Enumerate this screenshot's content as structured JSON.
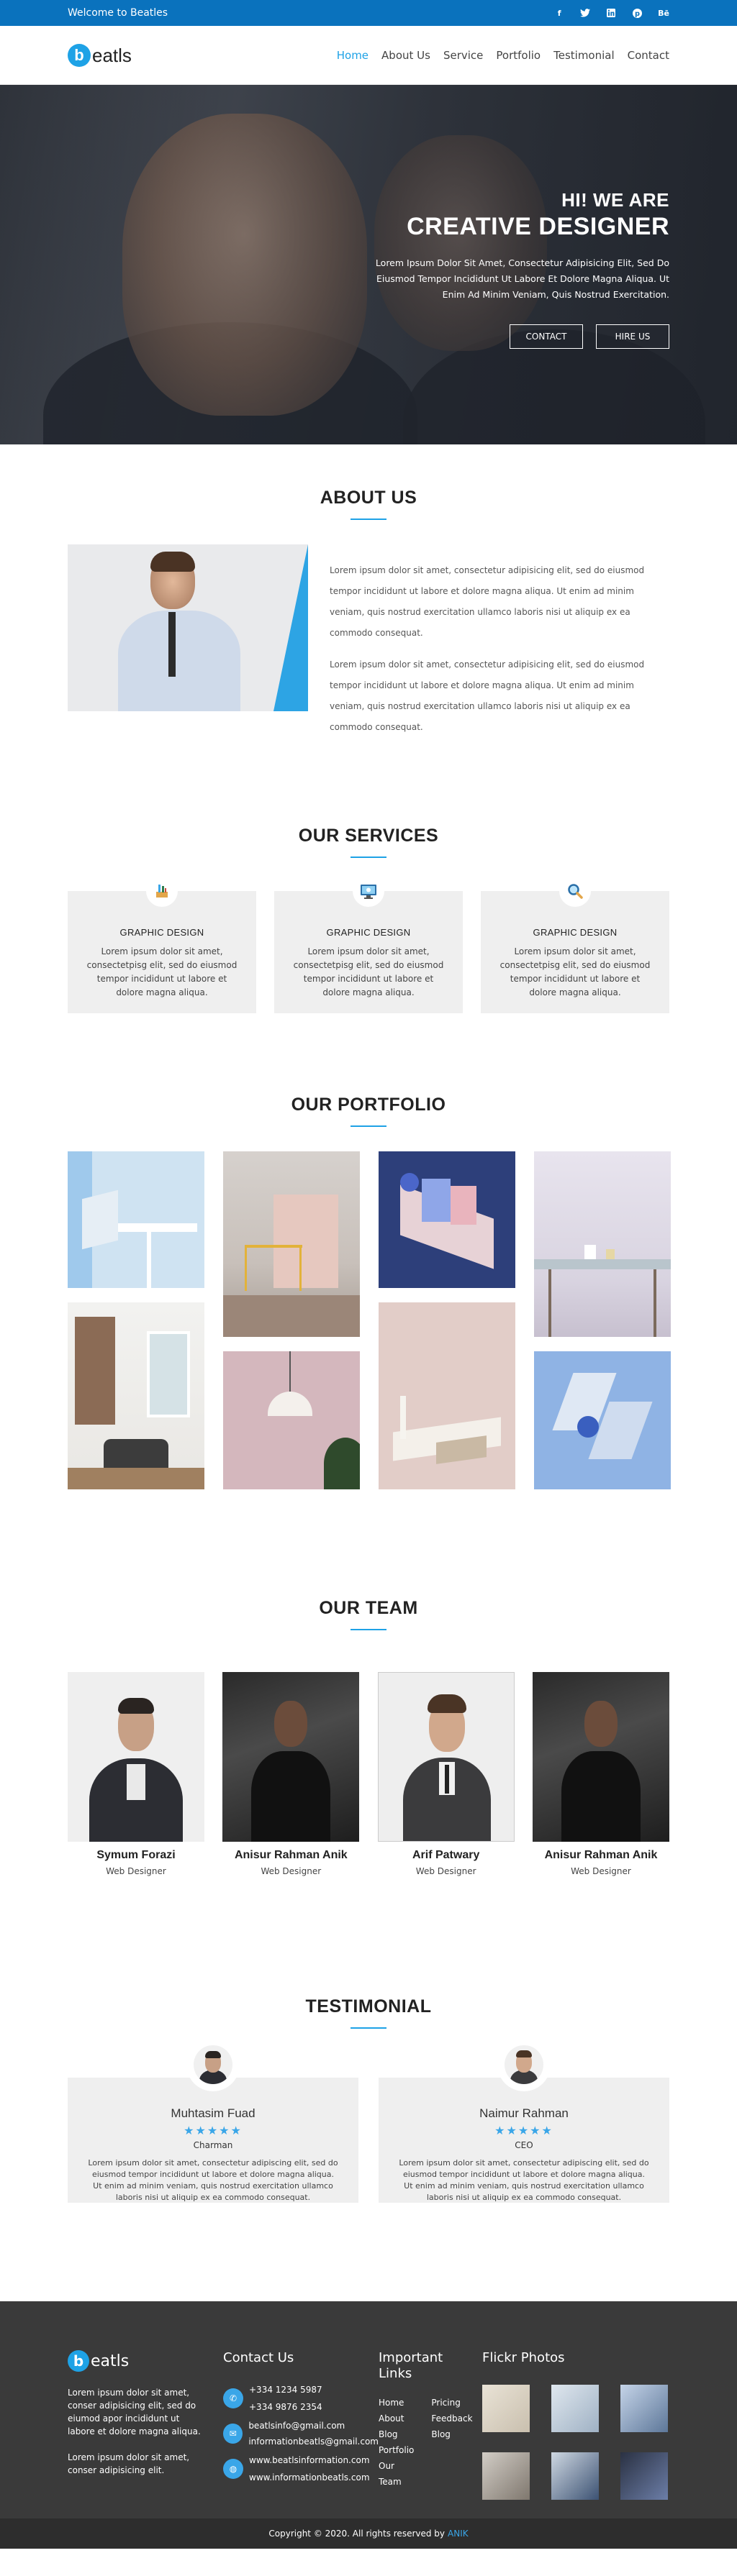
{
  "topbar": {
    "welcome": "Welcome to Beatles",
    "socials": [
      "facebook-icon",
      "twitter-icon",
      "linkedin-icon",
      "pinterest-icon",
      "behance-icon"
    ]
  },
  "header": {
    "logo_letter": "b",
    "logo_text": "eatls",
    "nav": [
      "Home",
      "About Us",
      "Service",
      "Portfolio",
      "Testimonial",
      "Contact"
    ],
    "active_nav": "Home"
  },
  "hero": {
    "kicker": "HI! WE ARE",
    "title": "CREATIVE DESIGNER",
    "text": "Lorem Ipsum Dolor Sit Amet, Consectetur Adipisicing Elit, Sed Do Eiusmod Tempor Incididunt Ut Labore Et Dolore Magna Aliqua. Ut Enim Ad Minim Veniam, Quis Nostrud Exercitation.",
    "btn_contact": "CONTACT",
    "btn_hire": "HIRE US"
  },
  "about": {
    "title": "ABOUT US",
    "para1": "Lorem ipsum dolor sit amet, consectetur adipisicing elit, sed do eiusmod tempor incididunt ut labore et dolore magna aliqua. Ut enim ad minim veniam, quis nostrud exercitation ullamco laboris nisi ut aliquip ex ea commodo consequat.",
    "para2": "Lorem ipsum dolor sit amet, consectetur adipisicing elit, sed do eiusmod tempor incididunt ut labore et dolore magna aliqua. Ut enim ad minim veniam, quis nostrud exercitation ullamco laboris nisi ut aliquip ex ea commodo consequat."
  },
  "services": {
    "title": "OUR SERVICES",
    "items": [
      {
        "icon": "pen-tools-icon",
        "title": "GRAPHIC DESIGN",
        "text": "Lorem ipsum dolor sit amet, consectetpisg elit, sed do eiusmod tempor incididunt ut labore et dolore magna aliqua."
      },
      {
        "icon": "monitor-icon",
        "title": "GRAPHIC DESIGN",
        "text": "Lorem ipsum dolor sit amet, consectetpisg elit, sed do eiusmod tempor incididunt ut labore et dolore magna aliqua."
      },
      {
        "icon": "magnifier-icon",
        "title": "GRAPHIC DESIGN",
        "text": "Lorem ipsum dolor sit amet, consectetpisg elit, sed do eiusmod tempor incididunt ut labore et dolore magna aliqua."
      }
    ]
  },
  "portfolio": {
    "title": "OUR PORTFOLIO"
  },
  "team": {
    "title": "OUR TEAM",
    "members": [
      {
        "name": "Symum Forazi",
        "role": "Web Designer"
      },
      {
        "name": "Anisur Rahman Anik",
        "role": "Web Designer"
      },
      {
        "name": "Arif Patwary",
        "role": "Web Designer"
      },
      {
        "name": "Anisur Rahman Anik",
        "role": "Web Designer"
      }
    ]
  },
  "testimonial": {
    "title": "TESTIMONIAL",
    "items": [
      {
        "name": "Muhtasim Fuad",
        "stars": "★★★★★",
        "role": "Charman",
        "text": "Lorem ipsum dolor sit amet, consectetur adipiscing elit, sed do eiusmod tempor incididunt ut labore et dolore magna aliqua. Ut enim ad minim veniam, quis nostrud exercitation ullamco laboris nisi ut aliquip ex ea commodo consequat."
      },
      {
        "name": "Naimur Rahman",
        "stars": "★★★★★",
        "role": "CEO",
        "text": "Lorem ipsum dolor sit amet, consectetur adipiscing elit, sed do eiusmod tempor incididunt ut labore et dolore magna aliqua. Ut enim ad minim veniam, quis nostrud exercitation ullamco laboris nisi ut aliquip ex ea commodo consequat."
      }
    ]
  },
  "footer": {
    "logo_letter": "b",
    "logo_text": "eatls",
    "about1": "Lorem ipsum dolor sit amet, conser adipisicing elit, sed do eiumod apor incididunt ut labore et dolore magna aliqua.",
    "about2": "Lorem ipsum dolor sit amet, conser adipisicing elit.",
    "contact_title": "Contact Us",
    "phones": [
      "+334 1234 5987",
      "+334 9876 2354"
    ],
    "email": "beatlsinfo@gmail.com",
    "email2": "informationbeatls@gmail.com",
    "web1": "www.beatlsinformation.com",
    "web2": "www.informationbeatls.com",
    "links_title": "Important Links",
    "links_a": [
      "Home",
      "About",
      "Blog",
      "Portfolio",
      "Our Team"
    ],
    "links_b": [
      "Pricing",
      "Feedback",
      "Blog"
    ],
    "flickr_title": "Flickr Photos",
    "copyright": "Copyright © 2020. All rights reserved by",
    "copyright_link": "ANIK"
  },
  "colors": {
    "accent": "#1ea2e6",
    "topbar": "#0a72bd",
    "footer": "#3a3a3a"
  }
}
